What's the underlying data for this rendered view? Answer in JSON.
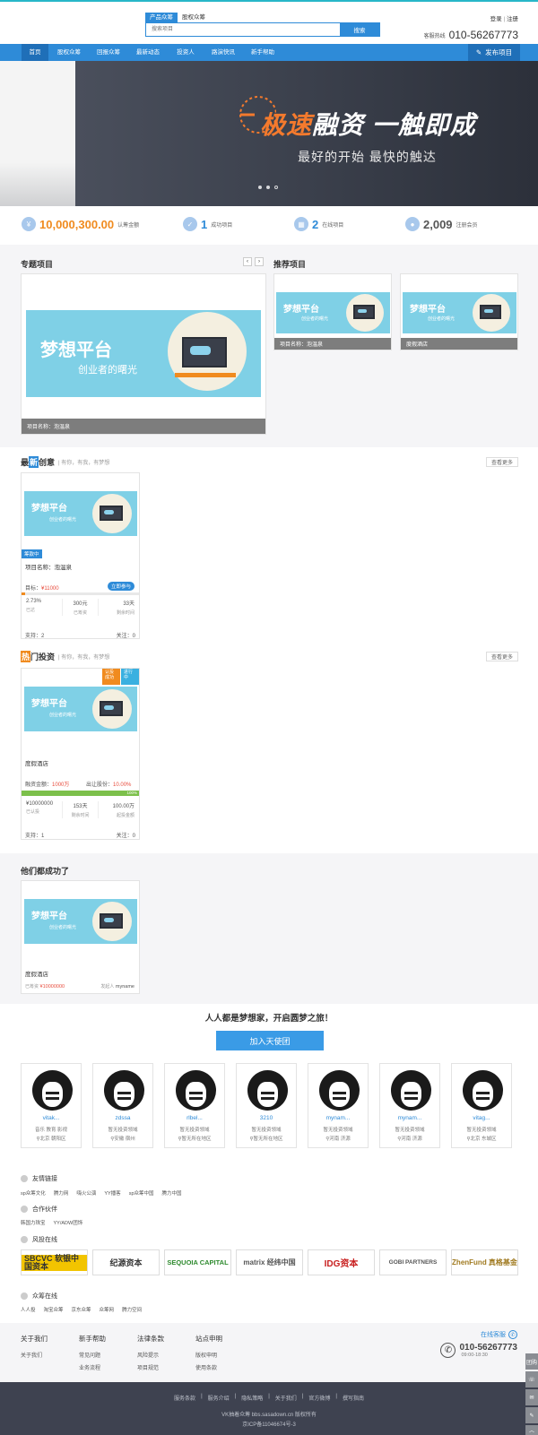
{
  "header": {
    "search_tabs": [
      "产品众筹",
      "股权众筹"
    ],
    "search_placeholder": "搜索项目",
    "search_button": "搜索",
    "login": "登录",
    "register": "注册",
    "hotline_label": "客服热线",
    "hotline": "010-56267773"
  },
  "nav": {
    "items": [
      "首页",
      "股权众筹",
      "回报众筹",
      "最新动态",
      "投资人",
      "路演快讯",
      "新手帮助"
    ],
    "publish": "发布项目"
  },
  "banner": {
    "slogan_hl": "极速",
    "slogan_rest": "融资 一触即成",
    "sub": "最好的开始 最快的触达"
  },
  "stats": [
    {
      "value": "10,000,300.00",
      "label": "认筹金额"
    },
    {
      "value": "1",
      "label": "成功项目"
    },
    {
      "value": "2",
      "label": "在线项目"
    },
    {
      "value": "2,009",
      "label": "注册会员"
    }
  ],
  "featured": {
    "title": "专题项目",
    "caption": "项目名称：泡温泉",
    "dream_title": "梦想平台",
    "dream_sub": "创业者的曙光"
  },
  "recommend": {
    "title": "推荐项目",
    "items": [
      {
        "caption": "项目名称：泡温泉"
      },
      {
        "caption": "度假酒店"
      }
    ]
  },
  "latest": {
    "title_pre": "最",
    "title_hl": "新",
    "title_post": "创意",
    "tagline": "| 有你，有我，有梦想",
    "more": "查看更多",
    "card": {
      "badge": "筹款中",
      "name": "项目名称：泡温泉",
      "target_label": "目标：",
      "target_value": "¥11000",
      "btn": "立即参与",
      "progress": 2.73,
      "cells": [
        {
          "v": "2.73%",
          "l": "已达"
        },
        {
          "v": "300元",
          "l": "已筹资"
        },
        {
          "v": "33天",
          "l": "剩余时间"
        }
      ],
      "support": "支持：2",
      "follow": "关注：0"
    }
  },
  "hot": {
    "title_hl": "热",
    "title_post": "门投资",
    "tagline": "| 有你，有我，有梦想",
    "more": "查看更多",
    "card": {
      "badge1": "认投成功",
      "badge2": "进行中",
      "name": "度假酒店",
      "amount_label": "融资金额：",
      "amount_value": "1000万",
      "share_label": "出让股份：",
      "share_value": "10.00%",
      "progress": 100,
      "progress_text": "100%",
      "cells": [
        {
          "v": "¥10000000",
          "l": "已认投"
        },
        {
          "v": "153天",
          "l": "剩余时间"
        },
        {
          "v": "100.00万",
          "l": "起投金额"
        }
      ],
      "support": "支持：1",
      "follow": "关注：0"
    }
  },
  "success": {
    "title": "他们都成功了",
    "card": {
      "name": "度假酒店",
      "raised_label": "已筹资",
      "raised_value": "¥10000000",
      "owner_label": "发起人",
      "owner": "myname"
    }
  },
  "angel": {
    "heading": "人人都是梦想家，开启圆梦之旅！",
    "button": "加入天使团",
    "members": [
      {
        "name": "vitak...",
        "l1": "音乐 教育 影视",
        "l2": "北京 朝阳区"
      },
      {
        "name": "zdssa",
        "l1": "暂无投资领域",
        "l2": "安徽 宿州"
      },
      {
        "name": "rlbel...",
        "l1": "暂无投资领域",
        "l2": "暂无所在地区"
      },
      {
        "name": "3210",
        "l1": "暂无投资领域",
        "l2": "暂无所在地区"
      },
      {
        "name": "mynam...",
        "l1": "暂无投资领域",
        "l2": "河南 济源"
      },
      {
        "name": "mynam...",
        "l1": "暂无投资领域",
        "l2": "河南 济源"
      },
      {
        "name": "vitag...",
        "l1": "暂无投资领域",
        "l2": "北京 东城区"
      }
    ]
  },
  "links": {
    "friend_title": "友情链接",
    "friend": [
      "sp众筹文化",
      "腾力网",
      "嗨火公演",
      "YY播客",
      "sp众筹中国",
      "腾力中国"
    ],
    "partner_title": "合作伙伴",
    "partner": [
      "韩国力珠宝",
      "YY/ADW团饰"
    ],
    "vc_title": "风投在线",
    "vc": [
      "SBCVC 软银中国资本",
      "纪源资本",
      "SEQUOIA CAPITAL",
      "matrix 经纬中国",
      "IDG资本",
      "GOBI PARTNERS",
      "ZhenFund 真格基金"
    ],
    "crowd_title": "众筹在线",
    "crowd": [
      "人人投",
      "淘宝众筹",
      "京东众筹",
      "众筹网",
      "腾力空间"
    ]
  },
  "footer": {
    "cols": [
      {
        "h": "关于我们",
        "items": [
          "关于我们"
        ]
      },
      {
        "h": "新手帮助",
        "items": [
          "常见问题",
          "业务流程"
        ]
      },
      {
        "h": "法律条款",
        "items": [
          "风险提示",
          "项目规范"
        ]
      },
      {
        "h": "站点申明",
        "items": [
          "版权申明",
          "使用条款"
        ]
      }
    ],
    "service": "在线客服",
    "phone": "010-56267773",
    "hours": "09:00-18:30"
  },
  "bottom": {
    "links": [
      "服务条款",
      "服务介绍",
      "隐私策略",
      "关于我们",
      "官方微博",
      "撰写指南"
    ],
    "copyright": "VK抽着众筹 bbs.sasadown.cn 版权所有",
    "icp": "京ICP备11046674号-3"
  },
  "sidebar": [
    "团购",
    "咨询",
    "反馈",
    "编辑",
    "顶部"
  ],
  "colors": {
    "primary": "#2e8bd8",
    "accent": "#f08b1f",
    "red": "#e84c3d",
    "dark": "#3e4250"
  }
}
